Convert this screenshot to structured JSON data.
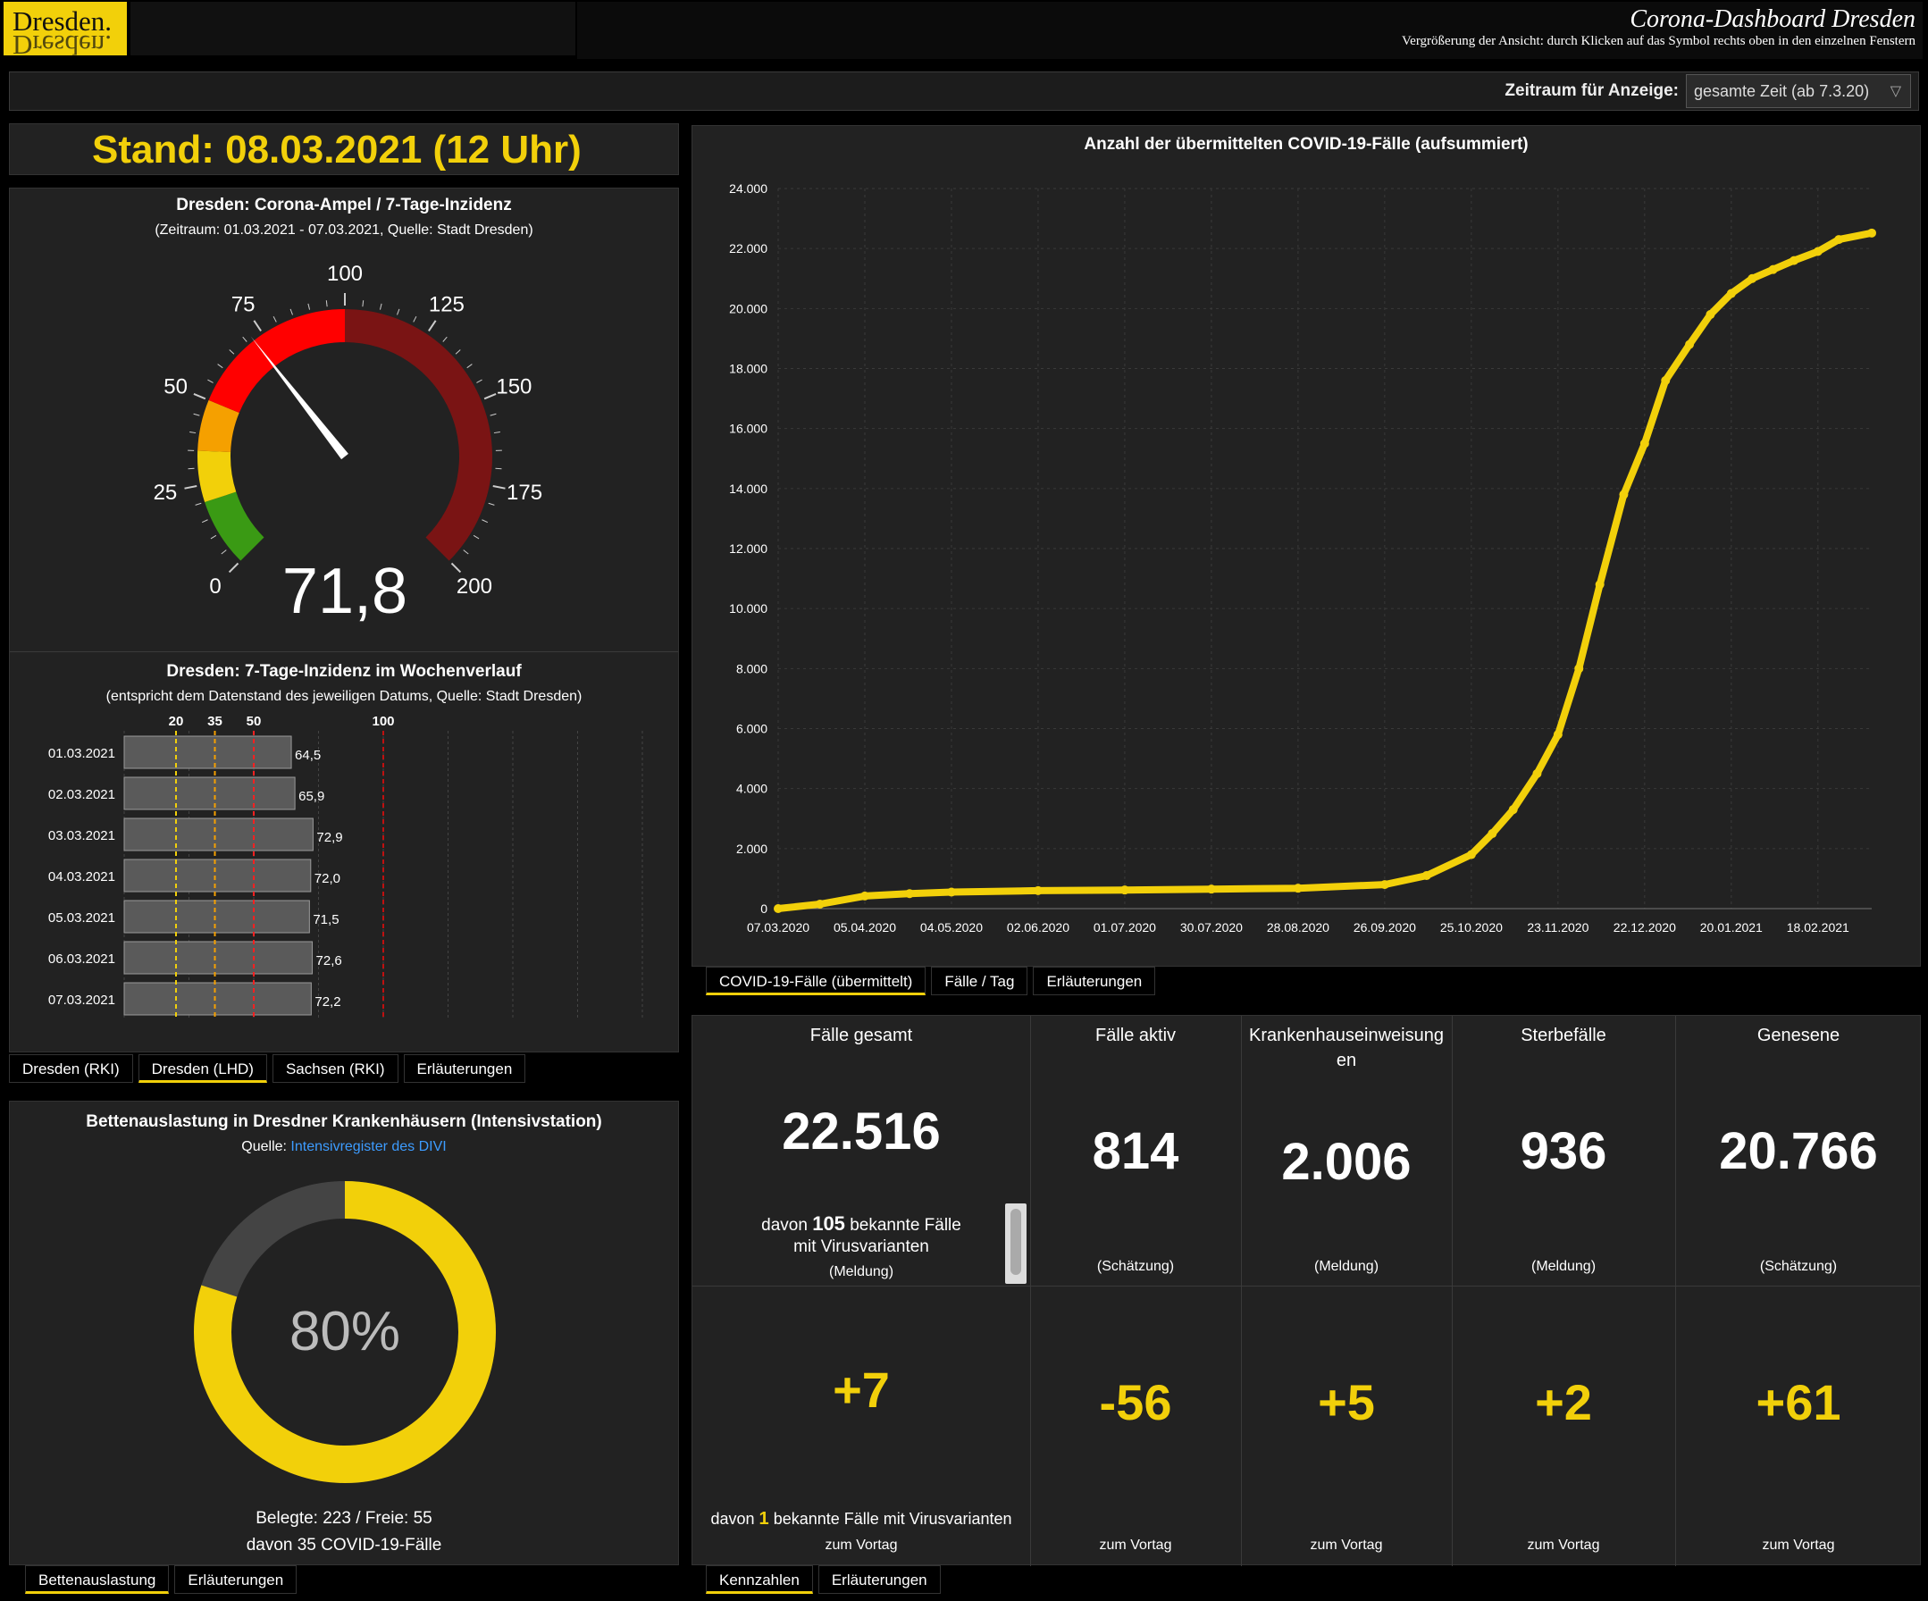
{
  "header": {
    "logo_text": "Dresden.",
    "title": "Corona-Dashboard Dresden",
    "subtitle": "Vergrößerung der Ansicht: durch Klicken auf das Symbol rechts oben in den einzelnen Fenstern"
  },
  "zeitraum": {
    "label": "Zeitraum für Anzeige:",
    "value": "gesamte Zeit (ab 7.3.20)"
  },
  "stand": "Stand: 08.03.2021 (12 Uhr)",
  "gauge": {
    "title": "Dresden: Corona-Ampel / 7-Tage-Inzidenz",
    "subtitle": "(Zeitraum: 01.03.2021 - 07.03.2021, Quelle: Stadt Dresden)",
    "value": 71.8,
    "value_label": "71,8",
    "min": 0,
    "max": 200,
    "ticks": [
      "0",
      "25",
      "50",
      "75",
      "100",
      "125",
      "150",
      "175",
      "200"
    ],
    "bands": [
      {
        "from": 0,
        "to": 20,
        "color": "#3a9a14"
      },
      {
        "from": 20,
        "to": 35,
        "color": "#f2d00a"
      },
      {
        "from": 35,
        "to": 50,
        "color": "#f5a000"
      },
      {
        "from": 50,
        "to": 100,
        "color": "#ff0000"
      },
      {
        "from": 100,
        "to": 200,
        "color": "#7a1414"
      }
    ]
  },
  "weekly": {
    "title": "Dresden: 7-Tage-Inzidenz im Wochenverlauf",
    "subtitle": "(entspricht dem Datenstand des jeweiligen Datums, Quelle: Stadt Dresden)",
    "threshold_labels": [
      "20",
      "35",
      "50",
      "100"
    ],
    "thresholds": [
      20,
      35,
      50,
      100
    ],
    "xmax": 200,
    "rows": [
      {
        "date": "01.03.2021",
        "value": 64.5,
        "label": "64,5"
      },
      {
        "date": "02.03.2021",
        "value": 65.9,
        "label": "65,9"
      },
      {
        "date": "03.03.2021",
        "value": 72.9,
        "label": "72,9"
      },
      {
        "date": "04.03.2021",
        "value": 72.0,
        "label": "72,0"
      },
      {
        "date": "05.03.2021",
        "value": 71.5,
        "label": "71,5"
      },
      {
        "date": "06.03.2021",
        "value": 72.6,
        "label": "72,6"
      },
      {
        "date": "07.03.2021",
        "value": 72.2,
        "label": "72,2"
      }
    ],
    "tabs": [
      "Dresden (RKI)",
      "Dresden (LHD)",
      "Sachsen (RKI)",
      "Erläuterungen"
    ],
    "active_tab": 1
  },
  "beds": {
    "title": "Bettenauslastung in Dresdner Krankenhäusern (Intensivstation)",
    "source_prefix": "Quelle:",
    "source_link": "Intensivregister des DIVI",
    "percent": 80,
    "percent_label": "80%",
    "line1": "Belegte: 223 / Freie: 55",
    "line2": "davon 35 COVID-19-Fälle",
    "tabs": [
      "Bettenauslastung",
      "Erläuterungen"
    ],
    "active_tab": 0,
    "colors": {
      "used": "#f2d00a",
      "free": "#444444"
    }
  },
  "chart_data": {
    "type": "line",
    "title": "Anzahl der übermittelten COVID-19-Fälle (aufsummiert)",
    "ylim": [
      0,
      24000
    ],
    "yticks": [
      "0",
      "2.000",
      "4.000",
      "6.000",
      "8.000",
      "10.000",
      "12.000",
      "14.000",
      "16.000",
      "18.000",
      "20.000",
      "22.000",
      "24.000"
    ],
    "xticks": [
      "07.03.2020",
      "05.04.2020",
      "04.05.2020",
      "02.06.2020",
      "01.07.2020",
      "30.07.2020",
      "28.08.2020",
      "26.09.2020",
      "25.10.2020",
      "23.11.2020",
      "22.12.2020",
      "20.01.2021",
      "18.02.2021"
    ],
    "x_start": "07.03.2020",
    "x_end": "08.03.2021",
    "series": [
      {
        "color": "#f2d00a",
        "x": [
          "07.03.2020",
          "21.03.2020",
          "05.04.2020",
          "20.04.2020",
          "04.05.2020",
          "02.06.2020",
          "01.07.2020",
          "30.07.2020",
          "28.08.2020",
          "26.09.2020",
          "10.10.2020",
          "25.10.2020",
          "01.11.2020",
          "08.11.2020",
          "16.11.2020",
          "23.11.2020",
          "30.11.2020",
          "07.12.2020",
          "15.12.2020",
          "22.12.2020",
          "29.12.2020",
          "06.01.2021",
          "13.01.2021",
          "20.01.2021",
          "27.01.2021",
          "03.02.2021",
          "10.02.2021",
          "18.02.2021",
          "25.02.2021",
          "08.03.2021"
        ],
        "y": [
          0,
          150,
          420,
          500,
          550,
          600,
          620,
          650,
          680,
          800,
          1100,
          1800,
          2500,
          3300,
          4500,
          5800,
          8000,
          10800,
          13800,
          15500,
          17600,
          18800,
          19800,
          20500,
          21000,
          21300,
          21600,
          21900,
          22300,
          22516
        ]
      }
    ],
    "tabs": [
      "COVID-19-Fälle (übermittelt)",
      "Fälle / Tag",
      "Erläuterungen"
    ],
    "active_tab": 0
  },
  "kpis": {
    "cells": [
      {
        "label": "Fälle gesamt",
        "value": "22.516",
        "note_pre": "davon",
        "note_num": "105",
        "note_post": "bekannte Fälle",
        "note_line2": "mit Virusvarianten",
        "note_sub": "(Meldung)"
      },
      {
        "label": "Fälle aktiv",
        "value": "814",
        "note": "(Schätzung)"
      },
      {
        "label": "Krankenhauseinweisungen",
        "value": "2.006",
        "note": "(Meldung)"
      },
      {
        "label": "Sterbefälle",
        "value": "936",
        "note": "(Meldung)"
      },
      {
        "label": "Genesene",
        "value": "20.766",
        "note": "(Schätzung)"
      }
    ],
    "changes": [
      {
        "value": "+7",
        "note_pre": "davon",
        "note_num": "1",
        "note_post": "bekannte Fälle mit Virusvarianten",
        "note": "zum Vortag"
      },
      {
        "value": "-56",
        "note": "zum Vortag"
      },
      {
        "value": "+5",
        "note": "zum Vortag"
      },
      {
        "value": "+2",
        "note": "zum Vortag"
      },
      {
        "value": "+61",
        "note": "zum Vortag"
      }
    ],
    "tabs": [
      "Kennzahlen",
      "Erläuterungen"
    ],
    "active_tab": 0
  }
}
